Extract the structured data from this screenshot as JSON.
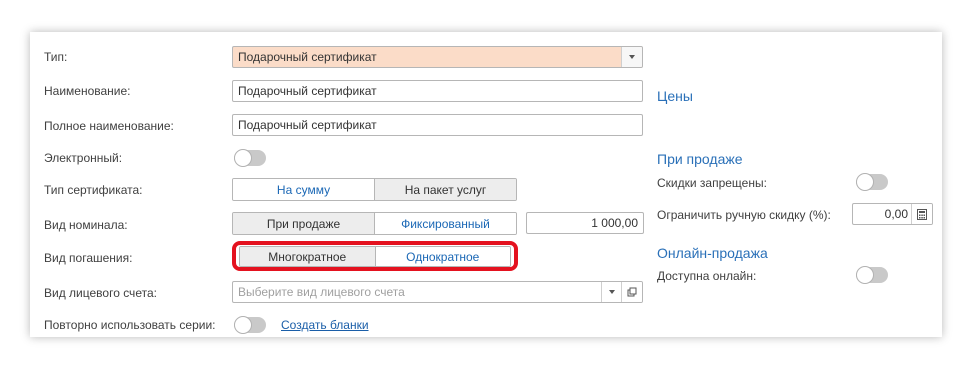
{
  "form": {
    "type": {
      "label": "Тип:",
      "value": "Подарочный сертификат"
    },
    "name": {
      "label": "Наименование:",
      "value": "Подарочный сертификат"
    },
    "full_name": {
      "label": "Полное наименование:",
      "value": "Подарочный сертификат"
    },
    "electronic": {
      "label": "Электронный:",
      "enabled": false
    },
    "cert_type": {
      "label": "Тип сертификата:",
      "options": [
        "На сумму",
        "На пакет услуг"
      ],
      "selected": "На пакет услуг"
    },
    "nominal_kind": {
      "label": "Вид номинала:",
      "options": [
        "При продаже",
        "Фиксированный"
      ],
      "selected": "При продаже",
      "amount": "1 000,00"
    },
    "redemption": {
      "label": "Вид погашения:",
      "options": [
        "Многократное",
        "Однократное"
      ],
      "selected": "Многократное"
    },
    "account_kind": {
      "label": "Вид лицевого счета:",
      "placeholder": "Выберите вид лицевого счета"
    },
    "reuse_series": {
      "label": "Повторно использовать серии:",
      "enabled": false,
      "link": "Создать бланки"
    }
  },
  "right": {
    "prices_title": "Цены",
    "on_sale_title": "При продаже",
    "discounts_forbidden": {
      "label": "Скидки запрещены:",
      "enabled": false
    },
    "limit_manual_discount": {
      "label": "Ограничить ручную скидку (%):",
      "value": "0,00"
    },
    "online_title": "Онлайн-продажа",
    "available_online": {
      "label": "Доступна онлайн:",
      "enabled": false
    }
  },
  "colors": {
    "accent_link": "#1a67b5",
    "highlight_field": "#fbdcc8",
    "annotation_red": "#e4121f"
  }
}
